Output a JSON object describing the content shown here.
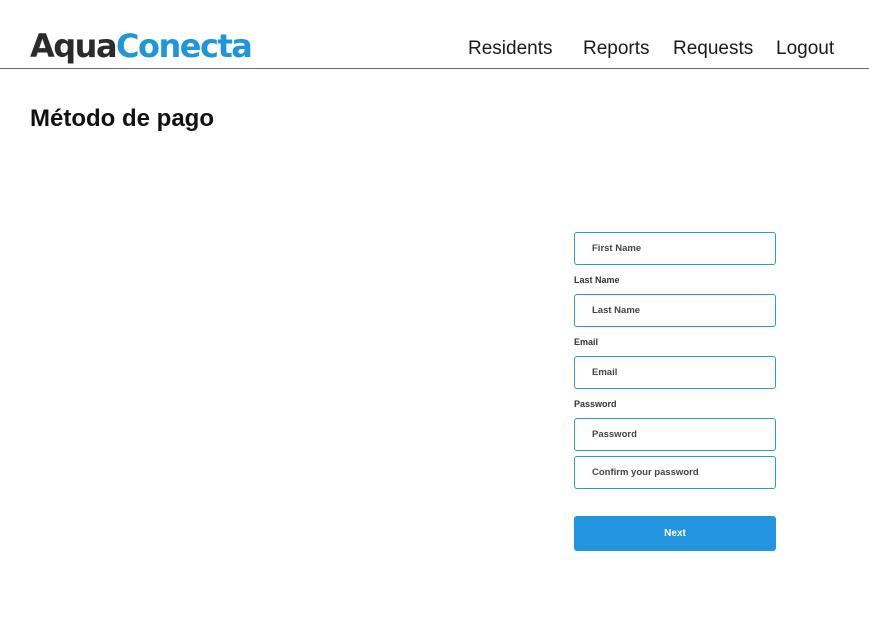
{
  "app": {
    "logo_part1": "Aqua",
    "logo_part2": "Conecta"
  },
  "nav": {
    "items": [
      {
        "label": "Residents"
      },
      {
        "label": "Reports"
      },
      {
        "label": "Requests"
      },
      {
        "label": "Logout"
      }
    ]
  },
  "page": {
    "title": "Método de pago"
  },
  "form": {
    "first_name": {
      "placeholder": "First Name",
      "value": ""
    },
    "last_name": {
      "label": "Last Name",
      "placeholder": "Last Name",
      "value": ""
    },
    "email": {
      "label": "Email",
      "placeholder": "Email",
      "value": ""
    },
    "password": {
      "label": "Password",
      "placeholder": "Password",
      "value": ""
    },
    "confirm_password": {
      "placeholder": "Confirm your password",
      "value": ""
    },
    "next_label": "Next"
  },
  "colors": {
    "brand_dark": "#2b2b2b",
    "brand_accent": "#1f95dd",
    "button": "#2394e0",
    "input_border": "#2a9ad8"
  }
}
